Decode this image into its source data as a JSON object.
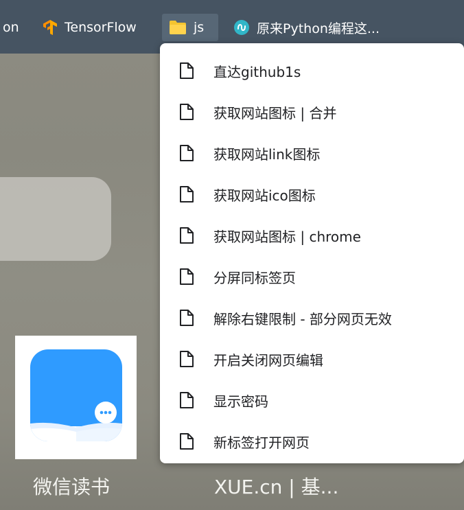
{
  "bookmarks_bar": {
    "items": [
      {
        "label": "on",
        "icon": "none"
      },
      {
        "label": "TensorFlow",
        "icon": "tensorflow-icon"
      },
      {
        "label": "js",
        "icon": "folder-icon"
      },
      {
        "label": "原来Python编程这...",
        "icon": "site-favicon-icon"
      }
    ]
  },
  "folder_menu": {
    "items": [
      {
        "label": "直达github1s"
      },
      {
        "label": "获取网站图标 | 合并"
      },
      {
        "label": "获取网站link图标"
      },
      {
        "label": "获取网站ico图标"
      },
      {
        "label": "获取网站图标 | chrome"
      },
      {
        "label": "分屏同标签页"
      },
      {
        "label": "解除右键限制 - 部分网页无效"
      },
      {
        "label": "开启关闭网页编辑"
      },
      {
        "label": "显示密码"
      },
      {
        "label": "新标签打开网页"
      }
    ]
  },
  "shortcuts": {
    "weread": {
      "label": "微信读书"
    },
    "xue": {
      "label": "XUE.cn | 基..."
    }
  },
  "colors": {
    "bookmarks_bar_bg": "#465462",
    "active_bookmark_bg": "#576776",
    "folder_yellow": "#f4c430",
    "tensorflow_orange": "#ff8f00",
    "weread_blue": "#2f9bff"
  }
}
